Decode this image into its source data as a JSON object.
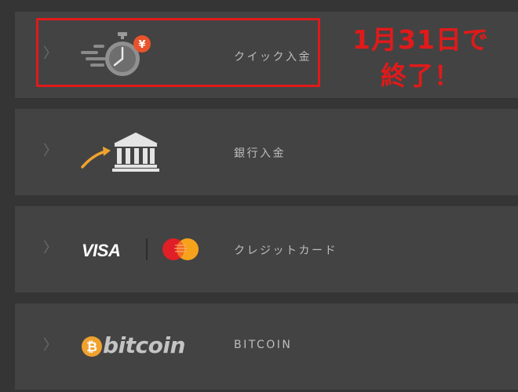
{
  "payment_methods": [
    {
      "label": "クイック入金",
      "icon": "quick-deposit-stopwatch-yen-icon"
    },
    {
      "label": "銀行入金",
      "icon": "bank-transfer-icon"
    },
    {
      "label": "クレジットカード",
      "icon": "visa-mastercard-icon",
      "brand_text": "VISA"
    },
    {
      "label": "BITCOIN",
      "icon": "bitcoin-logo-icon",
      "brand_text": "bitcoin",
      "coin_symbol": "₿"
    }
  ],
  "annotation": {
    "line1": "1月31日で",
    "line2": "終了！",
    "color": "#e01a1a"
  },
  "chevron": "〉",
  "colors": {
    "background": "#353535",
    "row": "#434343",
    "label": "#bdbdbd",
    "accent_orange": "#f0a22e",
    "yen_badge": "#e9532b"
  }
}
